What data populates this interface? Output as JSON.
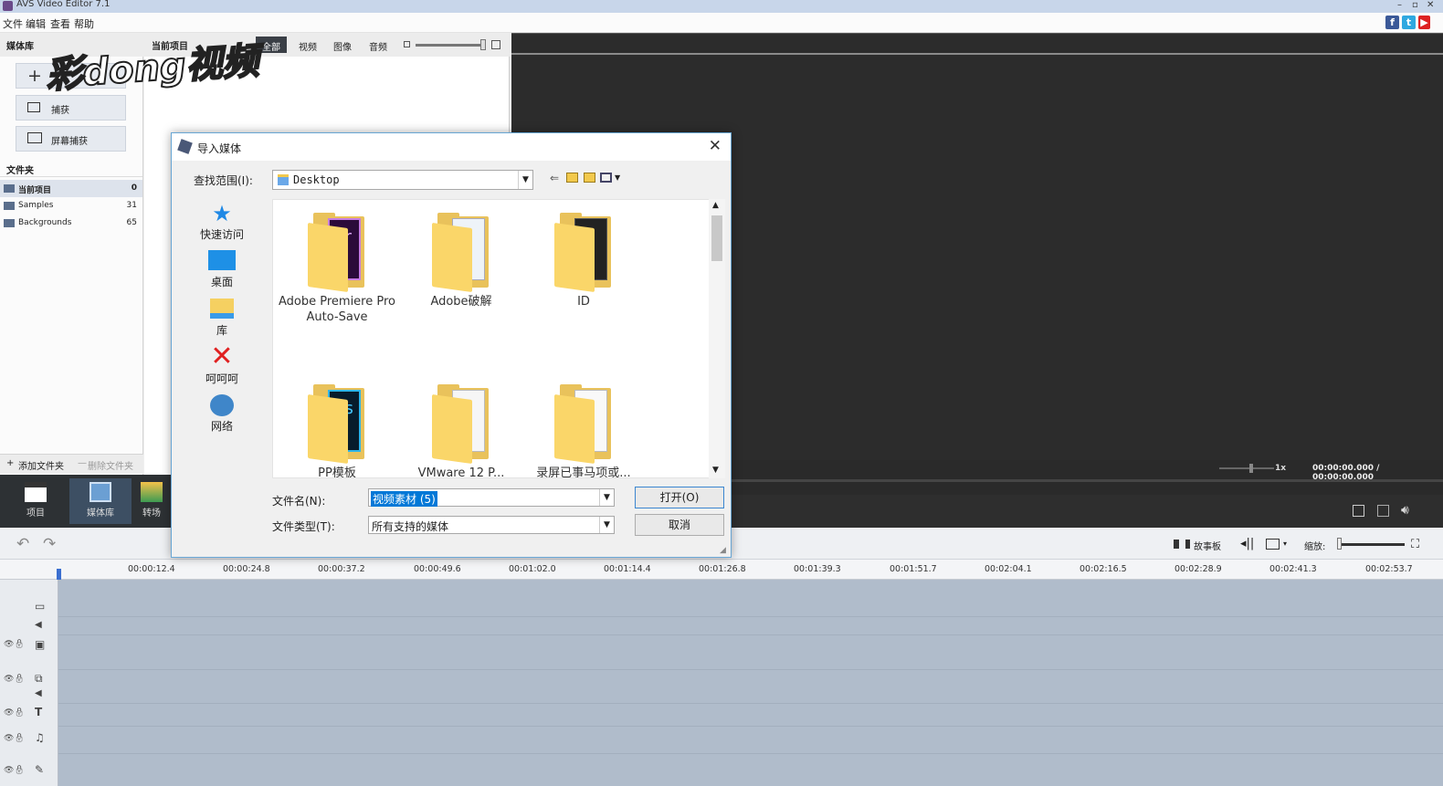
{
  "app": {
    "title": "AVS Video Editor 7.1"
  },
  "menu": [
    "文件",
    "编辑",
    "查看",
    "帮助"
  ],
  "watermark": "彩dong视频",
  "library": {
    "header": "媒体库",
    "project_label": "当前项目",
    "filters": [
      "全部",
      "视频",
      "图像",
      "音频"
    ],
    "add_icon": "+",
    "capture": "捕获",
    "screen_capture": "屏幕捕获",
    "folders_title": "文件夹",
    "folders": [
      {
        "name": "当前项目",
        "count": "0"
      },
      {
        "name": "Samples",
        "count": "31"
      },
      {
        "name": "Backgrounds",
        "count": "65"
      }
    ],
    "add_folder": "添加文件夹",
    "delete_folder": "删除文件夹"
  },
  "nav": [
    "项目",
    "媒体库",
    "转场"
  ],
  "preview": {
    "speed": "1x",
    "time": "00:00:00.000 / 00:00:00.000"
  },
  "timeline": {
    "storyboard": "故事板",
    "zoom_label": "缩放:",
    "ticks": [
      "00:00:12.4",
      "00:00:24.8",
      "00:00:37.2",
      "00:00:49.6",
      "00:01:02.0",
      "00:01:14.4",
      "00:01:26.8",
      "00:01:39.3",
      "00:01:51.7",
      "00:02:04.1",
      "00:02:16.5",
      "00:02:28.9",
      "00:02:41.3",
      "00:02:53.7"
    ]
  },
  "dialog": {
    "title": "导入媒体",
    "look_in_label": "查找范围(I):",
    "look_in_value": "Desktop",
    "places": [
      "快速访问",
      "桌面",
      "库",
      "呵呵呵",
      "网络"
    ],
    "files": [
      {
        "name": "Adobe Premiere Pro Auto-Save",
        "badge": "Pr"
      },
      {
        "name": "Adobe破解",
        "badge": ""
      },
      {
        "name": "ID",
        "badge": ""
      },
      {
        "name": "PP模板",
        "badge": "Ps"
      },
      {
        "name": "VMware 12 P...",
        "badge": ""
      },
      {
        "name": "录屏已事马项或...",
        "badge": ""
      }
    ],
    "filename_label": "文件名(N):",
    "filename_value": "视频素材 (5)",
    "filetype_label": "文件类型(T):",
    "filetype_value": "所有支持的媒体",
    "open_button": "打开(O)",
    "cancel_button": "取消"
  },
  "colors": {
    "accent": "#3b86d0",
    "preview_bg": "#2c2c2c",
    "timeline_bg": "#b0bccb"
  }
}
